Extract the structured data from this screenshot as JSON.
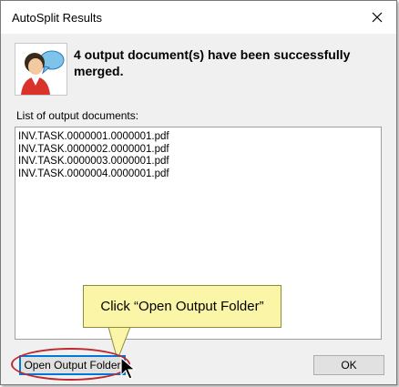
{
  "window": {
    "title": "AutoSplit Results",
    "close_icon": "close-icon"
  },
  "message": {
    "icon": "user-chat-icon",
    "text": "4 output document(s) have been successfully merged."
  },
  "output_list": {
    "label": "List of output documents:",
    "items": [
      "INV.TASK.0000001.0000001.pdf",
      "INV.TASK.0000002.0000001.pdf",
      "INV.TASK.0000003.0000001.pdf",
      "INV.TASK.0000004.0000001.pdf"
    ]
  },
  "buttons": {
    "open_output_folder": "Open Output Folder",
    "ok": "OK"
  },
  "annotation": {
    "callout_text": "Click “Open Output Folder”",
    "callout_color": "#fbf6a7",
    "highlight_color": "#c0262d"
  }
}
